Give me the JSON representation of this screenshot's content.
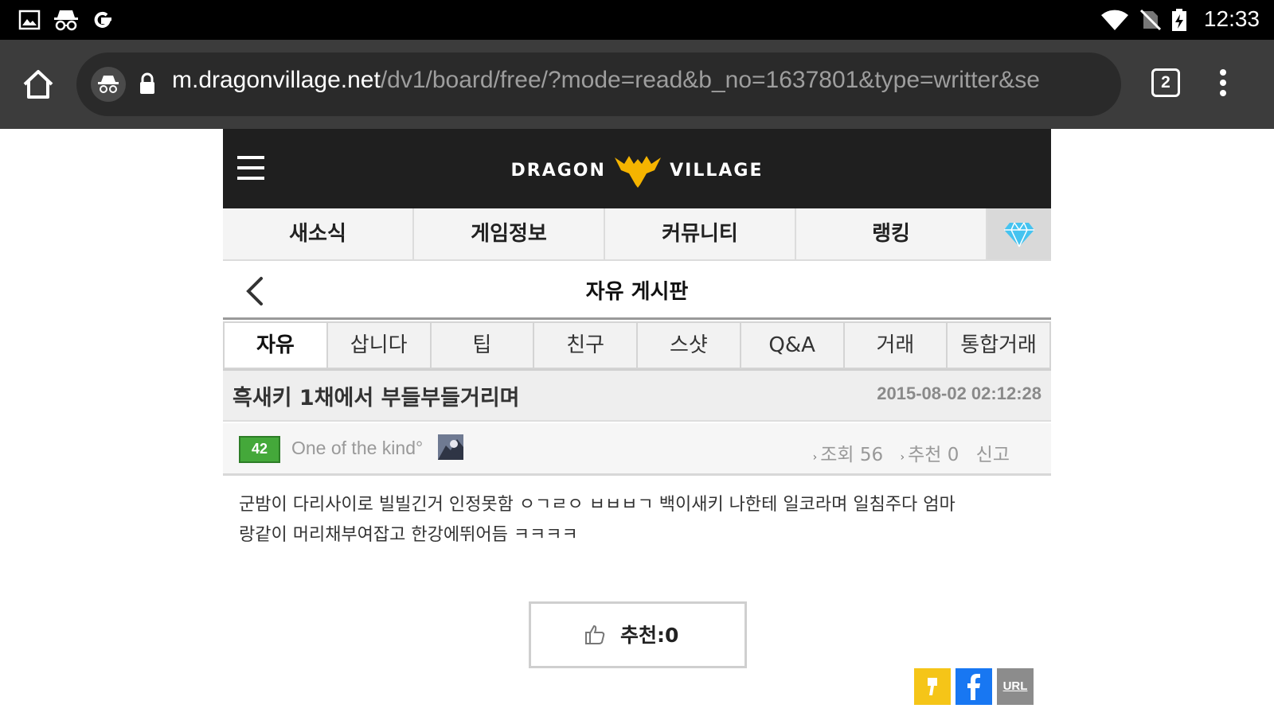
{
  "status_bar": {
    "time": "12:33",
    "left_icons": [
      "gallery-icon",
      "incognito-icon",
      "google-icon"
    ],
    "right_icons": [
      "wifi-icon",
      "no-sim-icon",
      "battery-charging-icon"
    ]
  },
  "browser": {
    "url_domain": "m.dragonvillage.net",
    "url_path": "/dv1/board/free/?mode=read&b_no=1637801&type=writter&se",
    "tab_count": "2"
  },
  "site": {
    "logo_left": "DRAGON",
    "logo_right": "VILLAGE",
    "nav": [
      "새소식",
      "게임정보",
      "커뮤니티",
      "랭킹"
    ],
    "board_title": "자유 게시판",
    "categories": [
      "자유",
      "삽니다",
      "팁",
      "친구",
      "스샷",
      "Q&A",
      "거래",
      "통합거래"
    ],
    "active_category": "자유"
  },
  "post": {
    "title": "흑새키 1채에서 부들부들거리며",
    "date": "2015-08-02 02:12:28",
    "level": "42",
    "author": "One of the kind°",
    "views_label": "조회 56",
    "recommend_label": "추천 0",
    "report_label": "신고",
    "body_line1": "군밤이 다리사이로 빌빌긴거 인정못함 ㅇㄱㄹㅇ ㅂㅂㅂㄱ 백이새키 나한테 일코라며 일침주다 엄마",
    "body_line2": "랑같이 머리채부여잡고 한강에뛰어듬 ㅋㅋㅋㅋ",
    "recommend_button": "추천:0"
  },
  "share": {
    "url_label": "URL"
  },
  "colors": {
    "status_bar": "#000000",
    "toolbar": "#3c3c3c",
    "site_header": "#1f1f1f",
    "logo_gold": "#f5b400",
    "level_badge": "#44a83a",
    "facebook": "#1877f2",
    "kakao": "#f5c518"
  }
}
